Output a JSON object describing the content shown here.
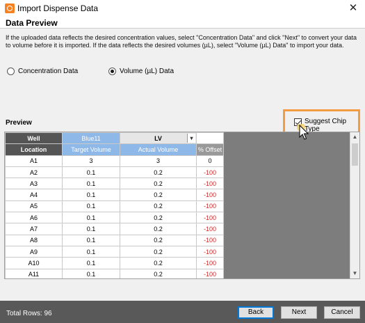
{
  "window": {
    "title": "Import Dispense Data",
    "close_glyph": "✕"
  },
  "section_title": "Data Preview",
  "description": "If the uploaded data reflects the desired concentration values, select \"Concentration Data\" and click \"Next\" to convert your data to volume before it is imported. If the data reflects the desired volumes (µL), select \"Volume (µL) Data\" to import your data.",
  "data_type": {
    "options": [
      {
        "label": "Concentration Data",
        "checked": false
      },
      {
        "label": "Volume (µL) Data",
        "checked": true
      }
    ]
  },
  "preview": {
    "label": "Preview",
    "suggest_chip_type": {
      "label": "Suggest Chip Type",
      "checked": true
    }
  },
  "grid": {
    "header_row1": {
      "well": "Well",
      "source": "Blue11",
      "chip_type": "LV",
      "offset": ""
    },
    "header_row2": {
      "location": "Location",
      "target": "Target Volume",
      "actual": "Actual Volume",
      "offset": "% Offset"
    },
    "rows": [
      {
        "location": "A1",
        "target": "3",
        "actual": "3",
        "offset": "0"
      },
      {
        "location": "A2",
        "target": "0.1",
        "actual": "0.2",
        "offset": "-100"
      },
      {
        "location": "A3",
        "target": "0.1",
        "actual": "0.2",
        "offset": "-100"
      },
      {
        "location": "A4",
        "target": "0.1",
        "actual": "0.2",
        "offset": "-100"
      },
      {
        "location": "A5",
        "target": "0.1",
        "actual": "0.2",
        "offset": "-100"
      },
      {
        "location": "A6",
        "target": "0.1",
        "actual": "0.2",
        "offset": "-100"
      },
      {
        "location": "A7",
        "target": "0.1",
        "actual": "0.2",
        "offset": "-100"
      },
      {
        "location": "A8",
        "target": "0.1",
        "actual": "0.2",
        "offset": "-100"
      },
      {
        "location": "A9",
        "target": "0.1",
        "actual": "0.2",
        "offset": "-100"
      },
      {
        "location": "A10",
        "target": "0.1",
        "actual": "0.2",
        "offset": "-100"
      },
      {
        "location": "A11",
        "target": "0.1",
        "actual": "0.2",
        "offset": "-100"
      }
    ]
  },
  "footer": {
    "total_rows": "Total Rows:  96",
    "back_label": "Back",
    "next_label": "Next",
    "cancel_label": "Cancel"
  },
  "colors": {
    "accent_orange": "#f39c44",
    "grid_header_blue": "#8eb8e8",
    "negative_red": "#e02020"
  },
  "icons": {
    "app": "app-icon",
    "close": "close-icon",
    "cursor": "mouse-cursor-icon",
    "dropdown": "chevron-down-icon"
  }
}
